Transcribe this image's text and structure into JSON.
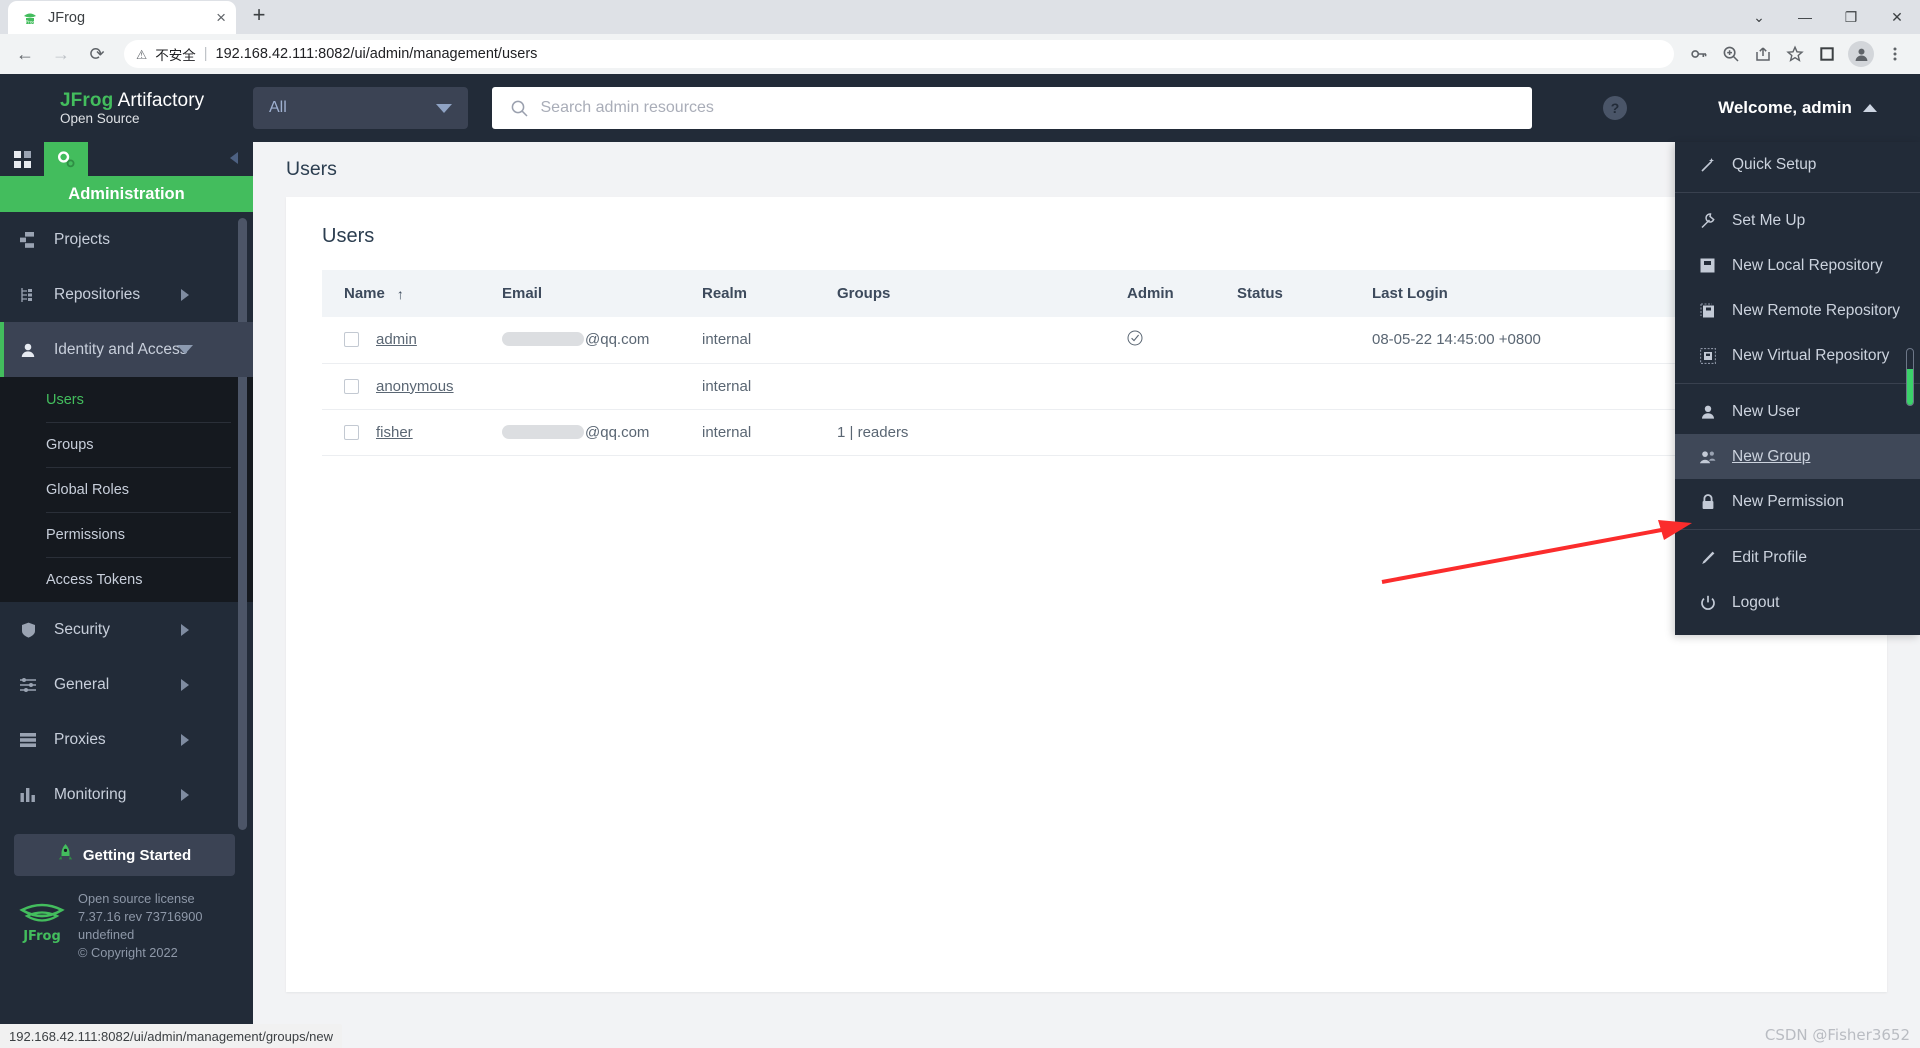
{
  "browser": {
    "tab": {
      "title": "JFrog",
      "favicon": "jfrog-favicon",
      "close_label": "×"
    },
    "new_tab_label": "+",
    "window_controls": [
      {
        "name": "chrome-more-tabs",
        "glyph": "⌄"
      },
      {
        "name": "minimize",
        "glyph": "—"
      },
      {
        "name": "restore",
        "glyph": "❐"
      },
      {
        "name": "close",
        "glyph": "✕"
      }
    ],
    "nav": {
      "back": "←",
      "forward": "→",
      "reload": "⟳"
    },
    "omnibox": {
      "warning_icon": "⚠",
      "security_label": "不安全",
      "divider": "|",
      "url": "192.168.42.111:8082/ui/admin/management/users"
    },
    "toolbar_icons": [
      {
        "name": "password-key-icon",
        "glyph": "⚷"
      },
      {
        "name": "zoom-icon",
        "glyph": "⌕"
      },
      {
        "name": "share-icon",
        "glyph": "↗"
      },
      {
        "name": "bookmark-star-icon",
        "glyph": "☆"
      },
      {
        "name": "side-panel-icon",
        "glyph": "□"
      },
      {
        "name": "profile-avatar-icon",
        "glyph": "●"
      },
      {
        "name": "chrome-menu-icon",
        "glyph": "⋮"
      }
    ],
    "status_url": "192.168.42.111:8082/ui/admin/management/groups/new"
  },
  "topbar": {
    "brand_strong": "JFrog",
    "brand_rest": " Artifactory",
    "brand_sub": "Open Source",
    "scope_select": "All",
    "search_placeholder": "Search admin resources",
    "help_label": "?",
    "welcome": "Welcome, admin"
  },
  "sidebar": {
    "tabs": [
      {
        "name": "application-tab",
        "icon": "grid-icon",
        "active": false
      },
      {
        "name": "administration-tab",
        "icon": "gear-icon",
        "active": true
      }
    ],
    "title": "Administration",
    "items": [
      {
        "label": "Projects",
        "icon": "projects-icon",
        "expandable": false
      },
      {
        "label": "Repositories",
        "icon": "repositories-icon",
        "expandable": true
      },
      {
        "label": "Identity and Access",
        "icon": "user-icon",
        "expandable": true,
        "open": true
      },
      {
        "label": "Security",
        "icon": "shield-icon",
        "expandable": true
      },
      {
        "label": "General",
        "icon": "sliders-icon",
        "expandable": true
      },
      {
        "label": "Proxies",
        "icon": "server-icon",
        "expandable": true
      },
      {
        "label": "Monitoring",
        "icon": "chart-icon",
        "expandable": true
      }
    ],
    "subitems": [
      {
        "label": "Users",
        "active": true
      },
      {
        "label": "Groups",
        "active": false
      },
      {
        "label": "Global Roles",
        "active": false
      },
      {
        "label": "Permissions",
        "active": false
      },
      {
        "label": "Access Tokens",
        "active": false
      }
    ],
    "getting_started": "Getting Started",
    "license": {
      "line1": "Open source license",
      "line2": "7.37.16 rev 73716900",
      "line3": "undefined",
      "line4": "© Copyright 2022"
    }
  },
  "main": {
    "page_title": "Users",
    "card_title": "Users",
    "table": {
      "sort_column": "Name",
      "sort_glyph": "↑",
      "columns": [
        "Name",
        "Email",
        "Realm",
        "Groups",
        "Admin",
        "Status",
        "Last Login"
      ],
      "rows": [
        {
          "name": "admin",
          "email_redacted": true,
          "email_suffix": "@qq.com",
          "realm": "internal",
          "groups": "",
          "admin": "✓",
          "status": "",
          "last_login": "08-05-22 14:45:00 +0800"
        },
        {
          "name": "anonymous",
          "email_redacted": false,
          "email_suffix": "",
          "realm": "internal",
          "groups": "",
          "admin": "",
          "status": "",
          "last_login": ""
        },
        {
          "name": "fisher",
          "email_redacted": true,
          "email_suffix": "@qq.com",
          "realm": "internal",
          "groups": "1 | readers",
          "admin": "",
          "status": "",
          "last_login": ""
        }
      ]
    }
  },
  "user_menu": {
    "groups": [
      [
        {
          "label": "Quick Setup",
          "icon": "magic-wand-icon"
        }
      ],
      [
        {
          "label": "Set Me Up",
          "icon": "wrench-icon"
        },
        {
          "label": "New Local Repository",
          "icon": "local-repo-icon"
        },
        {
          "label": "New Remote Repository",
          "icon": "remote-repo-icon"
        },
        {
          "label": "New Virtual Repository",
          "icon": "virtual-repo-icon"
        }
      ],
      [
        {
          "label": "New User",
          "icon": "user-icon"
        },
        {
          "label": "New Group",
          "icon": "group-icon",
          "highlighted": true
        },
        {
          "label": "New Permission",
          "icon": "lock-icon"
        }
      ],
      [
        {
          "label": "Edit Profile",
          "icon": "pencil-icon"
        },
        {
          "label": "Logout",
          "icon": "power-icon"
        }
      ]
    ]
  },
  "annotation": {
    "arrow_color": "#fb2c2c",
    "watermark": "CSDN @Fisher3652"
  },
  "colors": {
    "brand_green": "#43bd5d",
    "dark_nav": "#222b38",
    "sidebar_open": "#3b4354",
    "menu_highlight": "#3f4858"
  }
}
